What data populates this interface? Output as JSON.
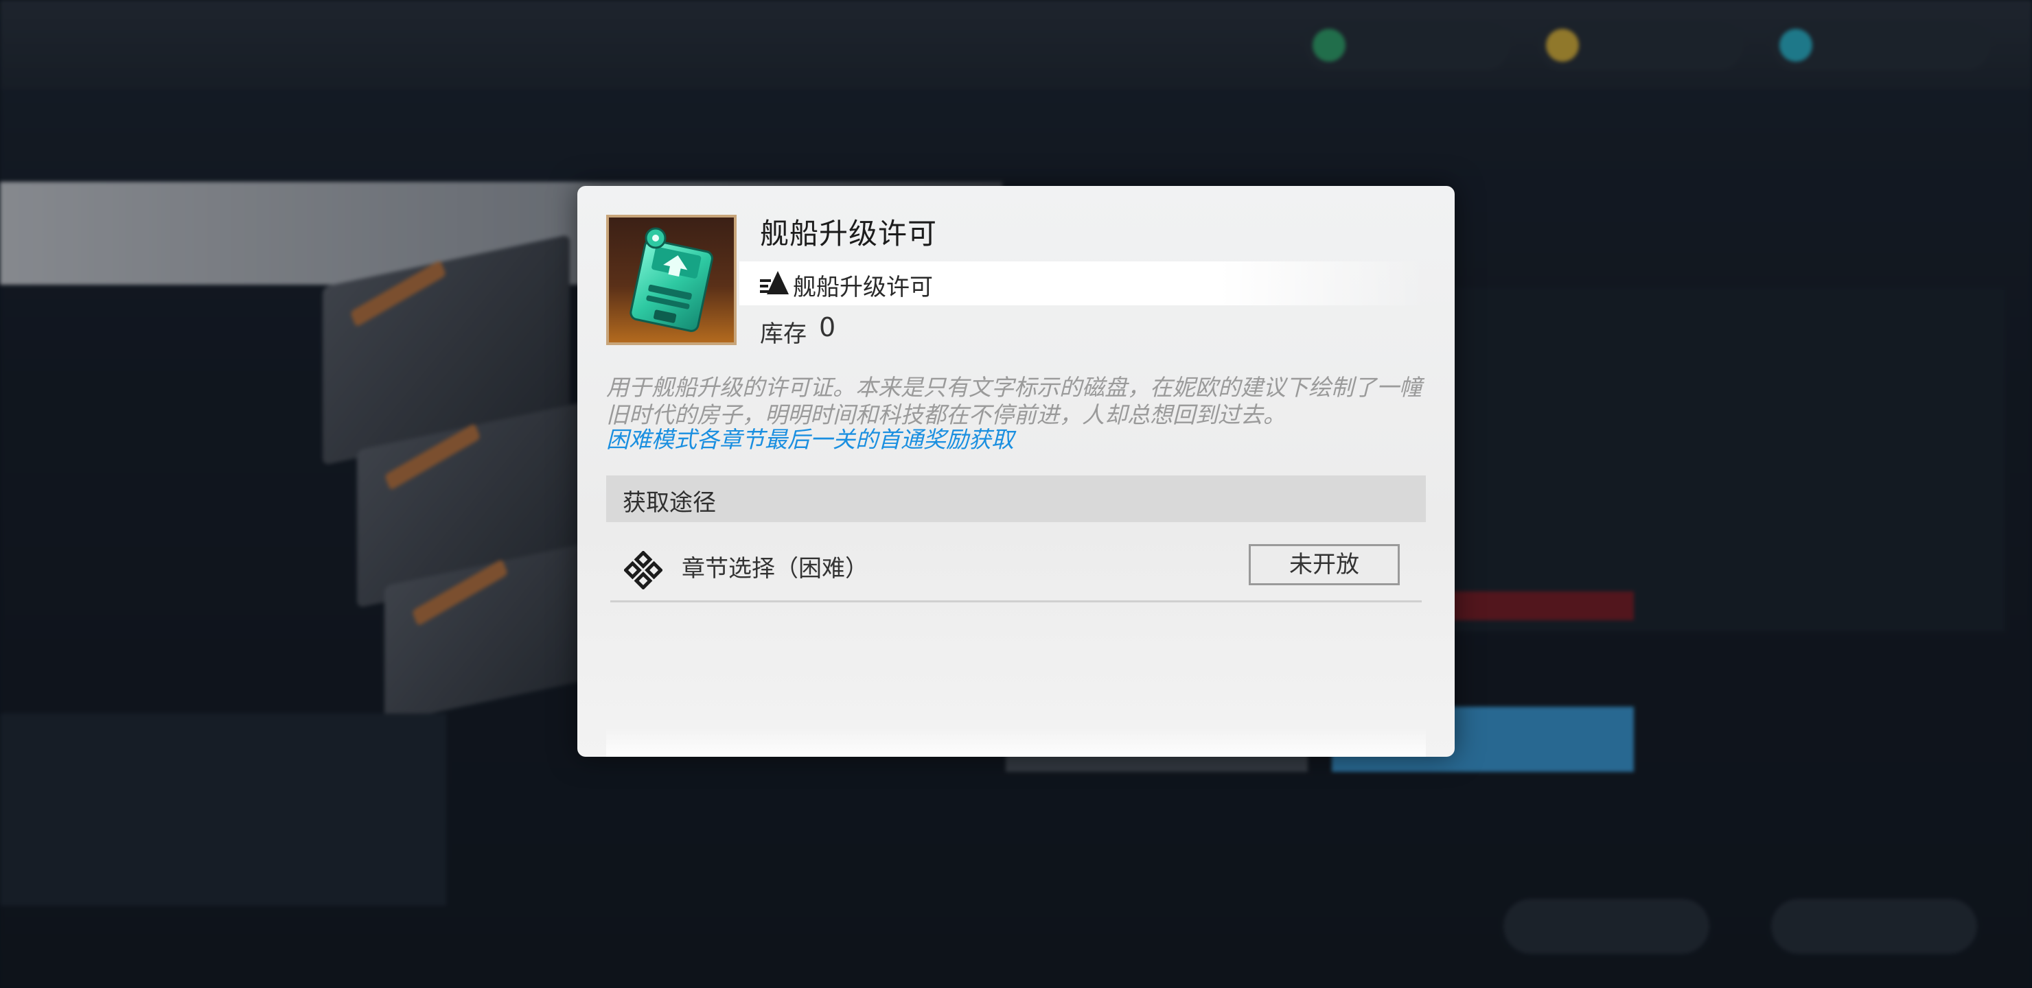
{
  "dialog": {
    "item_name": "舰船升级许可",
    "item_icon": "upgrade-disk-icon",
    "type_icon": "ship-type-icon",
    "type_label": "舰船升级许可",
    "stock_label": "库存",
    "stock_value": "0",
    "description": "用于舰船升级的许可证。本来是只有文字标示的磁盘，在妮欧的建议下绘制了一幢旧时代的房子，明明时间和科技都在不停前进，人却总想回到过去。",
    "hint": "困难模式各章节最后一关的首通奖励获取",
    "sources_header": "获取途径",
    "sources": [
      {
        "icon": "chapter-select-icon",
        "label": "章节选择（困难）",
        "status": "未开放"
      }
    ]
  },
  "colors": {
    "hint": "#1a8fe0",
    "description": "#9a9a9a",
    "icon_frame": "#c8a57a",
    "disk_green": "#3fd6b0"
  }
}
